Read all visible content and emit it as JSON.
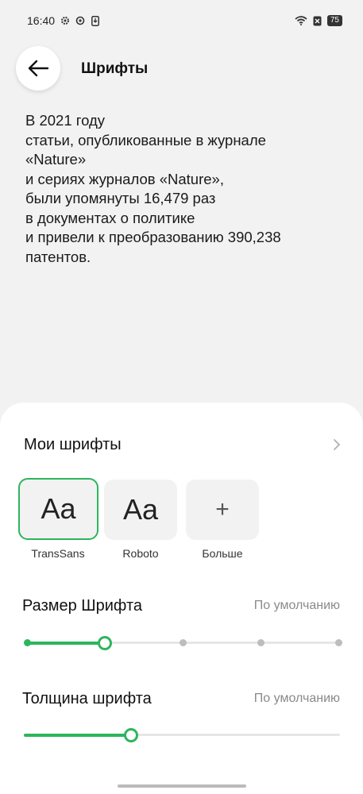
{
  "status_bar": {
    "time": "16:40",
    "battery": "75"
  },
  "header": {
    "title": "Шрифты"
  },
  "preview_lines": [
    "В 2021 году",
    "статьи, опубликованные в журнале",
    "«Nature»",
    "и сериях журналов «Nature»,",
    "были упомянуты 16,479 раз",
    "в документах о политике",
    "и привели к преобразованию 390,238",
    "патентов."
  ],
  "my_fonts": {
    "title": "Мои шрифты",
    "cards": [
      {
        "sample": "Aa",
        "caption": "TransSans",
        "selected": true
      },
      {
        "sample": "Aa",
        "caption": "Roboto",
        "selected": false
      },
      {
        "sample": "+",
        "caption": "Больше",
        "selected": false
      }
    ]
  },
  "font_size": {
    "label": "Размер Шрифта",
    "value": "По умолчанию",
    "level": 1,
    "steps": 5
  },
  "font_weight": {
    "label": "Толщина шрифта",
    "value": "По умолчанию",
    "fraction": 0.34
  },
  "colors": {
    "accent": "#2db55d",
    "background": "#f2f2f2",
    "sheet": "#ffffff"
  }
}
